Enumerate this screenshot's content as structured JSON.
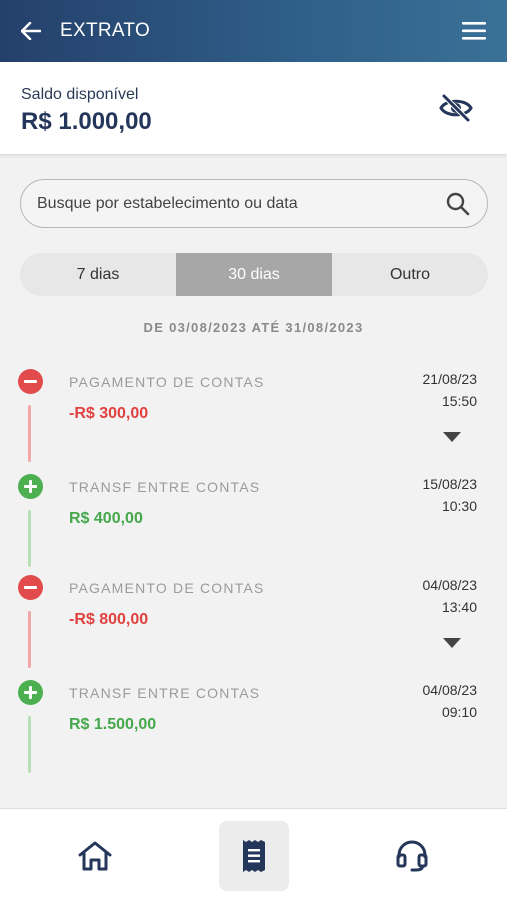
{
  "header": {
    "title": "EXTRATO",
    "back_icon": "arrow-left-icon",
    "menu_icon": "hamburger-menu-icon"
  },
  "balance": {
    "label": "Saldo disponível",
    "value": "R$ 1.000,00",
    "toggle_icon": "eye-slash-icon"
  },
  "search": {
    "placeholder": "Busque por estabelecimento ou data",
    "icon": "search-icon"
  },
  "periods": {
    "tabs": [
      "7 dias",
      "30 dias",
      "Outro"
    ],
    "selected": "30 dias"
  },
  "range": "DE 03/08/2023 ATÉ 31/08/2023",
  "transactions": [
    {
      "type": "debit",
      "description": "PAGAMENTO DE CONTAS",
      "amount": "-R$ 300,00",
      "date": "21/08/23",
      "time": "15:50",
      "expandable": true
    },
    {
      "type": "credit",
      "description": "TRANSF ENTRE CONTAS",
      "amount": "R$ 400,00",
      "date": "15/08/23",
      "time": "10:30",
      "expandable": false
    },
    {
      "type": "debit",
      "description": "PAGAMENTO DE CONTAS",
      "amount": "-R$ 800,00",
      "date": "04/08/23",
      "time": "13:40",
      "expandable": true
    },
    {
      "type": "credit",
      "description": "TRANSF ENTRE CONTAS",
      "amount": "R$ 1.500,00",
      "date": "04/08/23",
      "time": "09:10",
      "expandable": false
    }
  ],
  "bottom_nav": {
    "items": [
      "home-icon",
      "receipt-icon",
      "headset-support-icon"
    ],
    "active": "receipt-icon"
  },
  "colors": {
    "header": "#24406a",
    "negative": "#e24b4b",
    "positive": "#4caf50",
    "tab_active": "#a7a7a7"
  }
}
